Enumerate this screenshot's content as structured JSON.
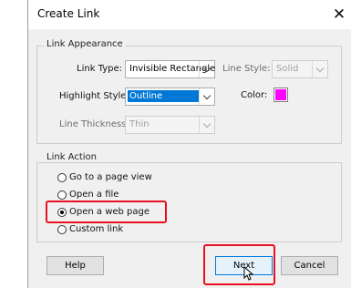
{
  "dialog": {
    "title": "Create Link",
    "close_glyph": "✕"
  },
  "appearance": {
    "group_title": "Link Appearance",
    "link_type_label": "Link Type:",
    "link_type_value": "Invisible Rectangle",
    "line_style_label": "Line Style:",
    "line_style_value": "Solid",
    "highlight_style_label": "Highlight Style:",
    "highlight_style_value": "Outline",
    "color_label": "Color:",
    "color_value": "#ff00ff",
    "line_thickness_label": "Line Thickness:",
    "line_thickness_value": "Thin"
  },
  "action": {
    "group_title": "Link Action",
    "options": [
      {
        "label": "Go to a page view",
        "selected": false
      },
      {
        "label": "Open a file",
        "selected": false
      },
      {
        "label": "Open a web page",
        "selected": true
      },
      {
        "label": "Custom link",
        "selected": false
      }
    ]
  },
  "buttons": {
    "help": "Help",
    "next": "Next",
    "cancel": "Cancel"
  },
  "highlight_color": "#e81123",
  "icons": {
    "close": "close-icon",
    "chevron": "chevron-down-icon",
    "cursor": "mouse-pointer-icon"
  }
}
